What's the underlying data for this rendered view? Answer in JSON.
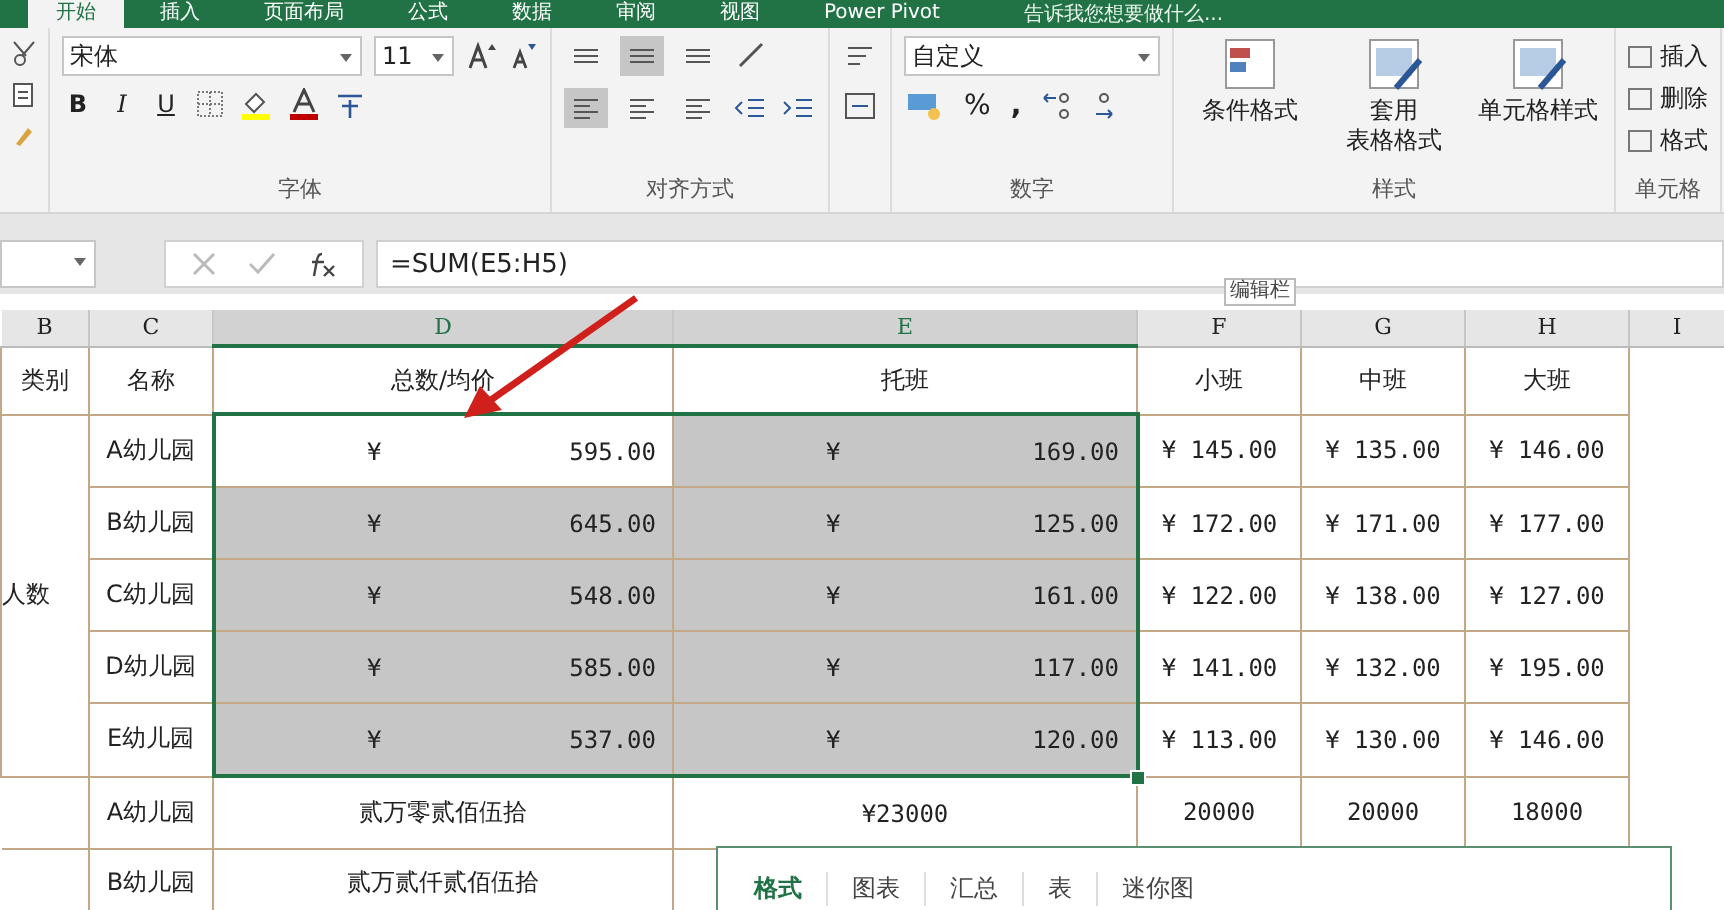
{
  "tabs": [
    {
      "label": "开始",
      "selected": true
    },
    {
      "label": "插入",
      "selected": false
    },
    {
      "label": "页面布局",
      "selected": false
    },
    {
      "label": "公式",
      "selected": false
    },
    {
      "label": "数据",
      "selected": false
    },
    {
      "label": "审阅",
      "selected": false
    },
    {
      "label": "视图",
      "selected": false
    },
    {
      "label": "Power Pivot",
      "selected": false
    }
  ],
  "tell_me": "告诉我您想要做什么...",
  "ribbon": {
    "font": {
      "name": "宋体",
      "size": "11",
      "label": "字体",
      "bold": "B",
      "italic": "I",
      "underline": "U"
    },
    "alignment": {
      "label": "对齐方式"
    },
    "number": {
      "format": "自定义",
      "percent": "%",
      "comma": ",",
      "label": "数字"
    },
    "styles": {
      "buttons": [
        [
          "条件格式"
        ],
        [
          "套用",
          "表格格式"
        ],
        [
          "单元格样式"
        ]
      ],
      "label": "样式"
    },
    "cells": {
      "buttons": [
        "插入",
        "删除",
        "格式"
      ],
      "label": "单元格"
    }
  },
  "formula_bar": {
    "formula": "=SUM(E5:H5)",
    "tooltip": "编辑栏"
  },
  "columns": [
    {
      "label": "B",
      "selected": false
    },
    {
      "label": "C",
      "selected": false
    },
    {
      "label": "D",
      "selected": true
    },
    {
      "label": "E",
      "selected": true
    },
    {
      "label": "F",
      "selected": false
    },
    {
      "label": "G",
      "selected": false
    },
    {
      "label": "H",
      "selected": false
    },
    {
      "label": "I",
      "selected": false
    }
  ],
  "header_row": [
    "类别",
    "名称",
    "总数/均价",
    "托班",
    "小班",
    "中班",
    "大班"
  ],
  "group_label": "人数",
  "price_rows": [
    {
      "name": "A幼儿园",
      "d": {
        "yen": "¥",
        "amount": "595.00",
        "selected": true,
        "active": true
      },
      "e": {
        "yen": "¥",
        "amount": "169.00",
        "selected": true,
        "active": false
      },
      "f": "¥ 145.00",
      "g": "¥ 135.00",
      "h": "¥ 146.00"
    },
    {
      "name": "B幼儿园",
      "d": {
        "yen": "¥",
        "amount": "645.00",
        "selected": true,
        "active": false
      },
      "e": {
        "yen": "¥",
        "amount": "125.00",
        "selected": true,
        "active": false
      },
      "f": "¥ 172.00",
      "g": "¥ 171.00",
      "h": "¥ 177.00"
    },
    {
      "name": "C幼儿园",
      "d": {
        "yen": "¥",
        "amount": "548.00",
        "selected": true,
        "active": false
      },
      "e": {
        "yen": "¥",
        "amount": "161.00",
        "selected": true,
        "active": false
      },
      "f": "¥ 122.00",
      "g": "¥ 138.00",
      "h": "¥ 127.00"
    },
    {
      "name": "D幼儿园",
      "d": {
        "yen": "¥",
        "amount": "585.00",
        "selected": true,
        "active": false
      },
      "e": {
        "yen": "¥",
        "amount": "117.00",
        "selected": true,
        "active": false
      },
      "f": "¥ 141.00",
      "g": "¥ 132.00",
      "h": "¥ 195.00"
    },
    {
      "name": "E幼儿园",
      "d": {
        "yen": "¥",
        "amount": "537.00",
        "selected": true,
        "active": false
      },
      "e": {
        "yen": "¥",
        "amount": "120.00",
        "selected": true,
        "active": false
      },
      "f": "¥ 113.00",
      "g": "¥ 130.00",
      "h": "¥ 146.00"
    }
  ],
  "total_rows": [
    {
      "name": "A幼儿园",
      "d": "贰万零贰佰伍拾",
      "e": "¥23000",
      "f": "20000",
      "g": "20000",
      "h": "18000"
    },
    {
      "name": "B幼儿园",
      "d": "贰万贰仟贰佰伍拾"
    }
  ],
  "quick_analysis": [
    {
      "label": "格式",
      "selected": true
    },
    {
      "label": "图表",
      "selected": false
    },
    {
      "label": "汇总",
      "selected": false
    },
    {
      "label": "表",
      "selected": false
    },
    {
      "label": "迷你图",
      "selected": false
    }
  ]
}
